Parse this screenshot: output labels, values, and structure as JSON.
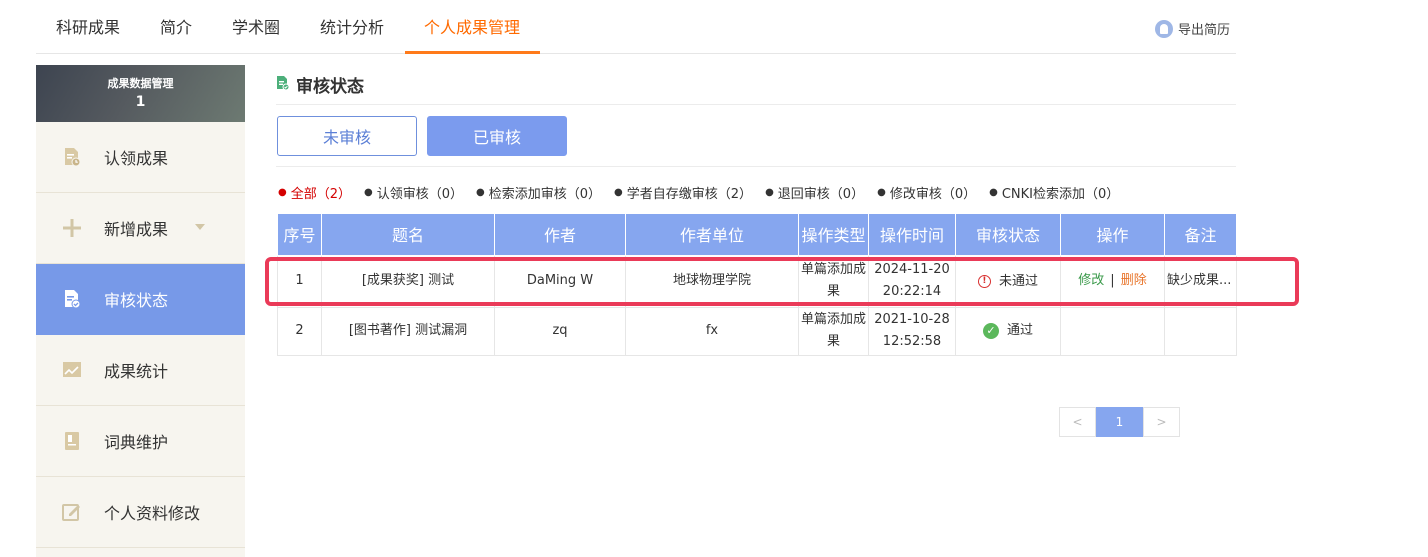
{
  "topnav": {
    "tabs": [
      {
        "label": "科研成果"
      },
      {
        "label": "简介"
      },
      {
        "label": "学术圈"
      },
      {
        "label": "统计分析"
      },
      {
        "label": "个人成果管理"
      }
    ],
    "active_tab": "个人成果管理",
    "export_label": "导出简历"
  },
  "sidebar": {
    "header_title": "成果数据管理",
    "header_count": "1",
    "items": [
      {
        "label": "认领成果",
        "icon": "document-clock-icon"
      },
      {
        "label": "新增成果",
        "icon": "plus-icon"
      },
      {
        "label": "审核状态",
        "icon": "document-check-icon"
      },
      {
        "label": "成果统计",
        "icon": "chart-icon"
      },
      {
        "label": "词典维护",
        "icon": "book-icon"
      },
      {
        "label": "个人资料修改",
        "icon": "edit-icon"
      }
    ],
    "active_item": "审核状态"
  },
  "main": {
    "section_title": "审核状态",
    "btn_unreviewed": "未审核",
    "btn_reviewed": "已审核",
    "filters": [
      {
        "label": "全部（2）",
        "active": true
      },
      {
        "label": "认领审核（0）"
      },
      {
        "label": "检索添加审核（0）"
      },
      {
        "label": "学者自存缴审核（2）"
      },
      {
        "label": "退回审核（0）"
      },
      {
        "label": "修改审核（0）"
      },
      {
        "label": "CNKI检索添加（0）"
      }
    ],
    "table": {
      "headers": [
        "序号",
        "题名",
        "作者",
        "作者单位",
        "操作类型",
        "操作时间",
        "审核状态",
        "操作",
        "备注"
      ],
      "rows": [
        {
          "no": "1",
          "title": "[成果获奖] 测试",
          "author": "DaMing W",
          "unit": "地球物理学院",
          "op_type": "单篇添加成果",
          "op_time": "2024-11-20 20:22:14",
          "status": "未通过",
          "action_edit": "修改",
          "action_sep": "|",
          "action_delete": "删除",
          "remark": "缺少成果..."
        },
        {
          "no": "2",
          "title": "[图书著作] 测试漏洞",
          "author": "zq",
          "unit": "fx",
          "op_type": "单篇添加成果",
          "op_time": "2021-10-28 12:52:58",
          "status": "通过",
          "remark": ""
        }
      ]
    },
    "pager": {
      "prev": "<",
      "current": "1",
      "next": ">"
    }
  },
  "colors": {
    "accent_orange": "#ff6a00",
    "accent_blue": "#7799e8",
    "table_header": "#86a6ef",
    "highlight": "#ea3a58"
  }
}
